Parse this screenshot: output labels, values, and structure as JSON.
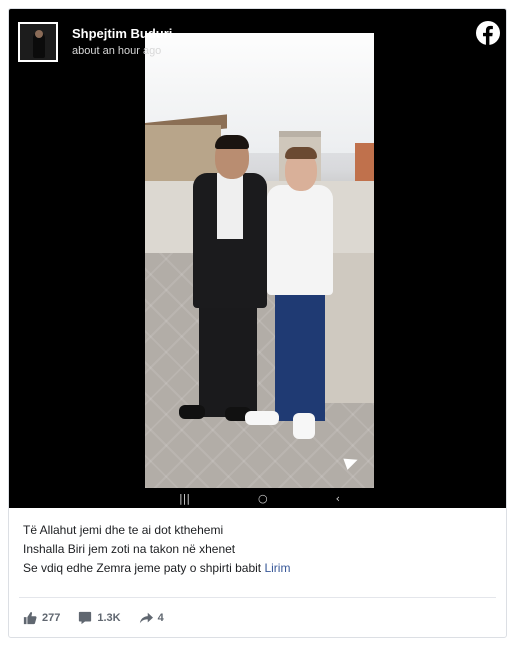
{
  "post": {
    "author": "Shpejtim Buduri",
    "timestamp": "about an hour ago",
    "text_lines": [
      "Të Allahut jemi dhe te ai dot kthehemi",
      "Inshalla Biri jem zoti na takon në xhenet",
      "Se vdiq edhe Zemra jeme paty o shpirti babit "
    ],
    "tag": "Lirim"
  },
  "media": {
    "navbar": {
      "recents": "|||",
      "home": "○",
      "back": "‹"
    }
  },
  "stats": {
    "likes": "277",
    "comments": "1.3K",
    "shares": "4"
  },
  "colors": {
    "facebook_brand": "#1c1e21",
    "link": "#385898",
    "stat_text": "#606770"
  },
  "icons": {
    "platform": "facebook-icon",
    "like": "thumbs-up-icon",
    "comment": "comment-bubble-icon",
    "share": "share-arrow-icon"
  }
}
